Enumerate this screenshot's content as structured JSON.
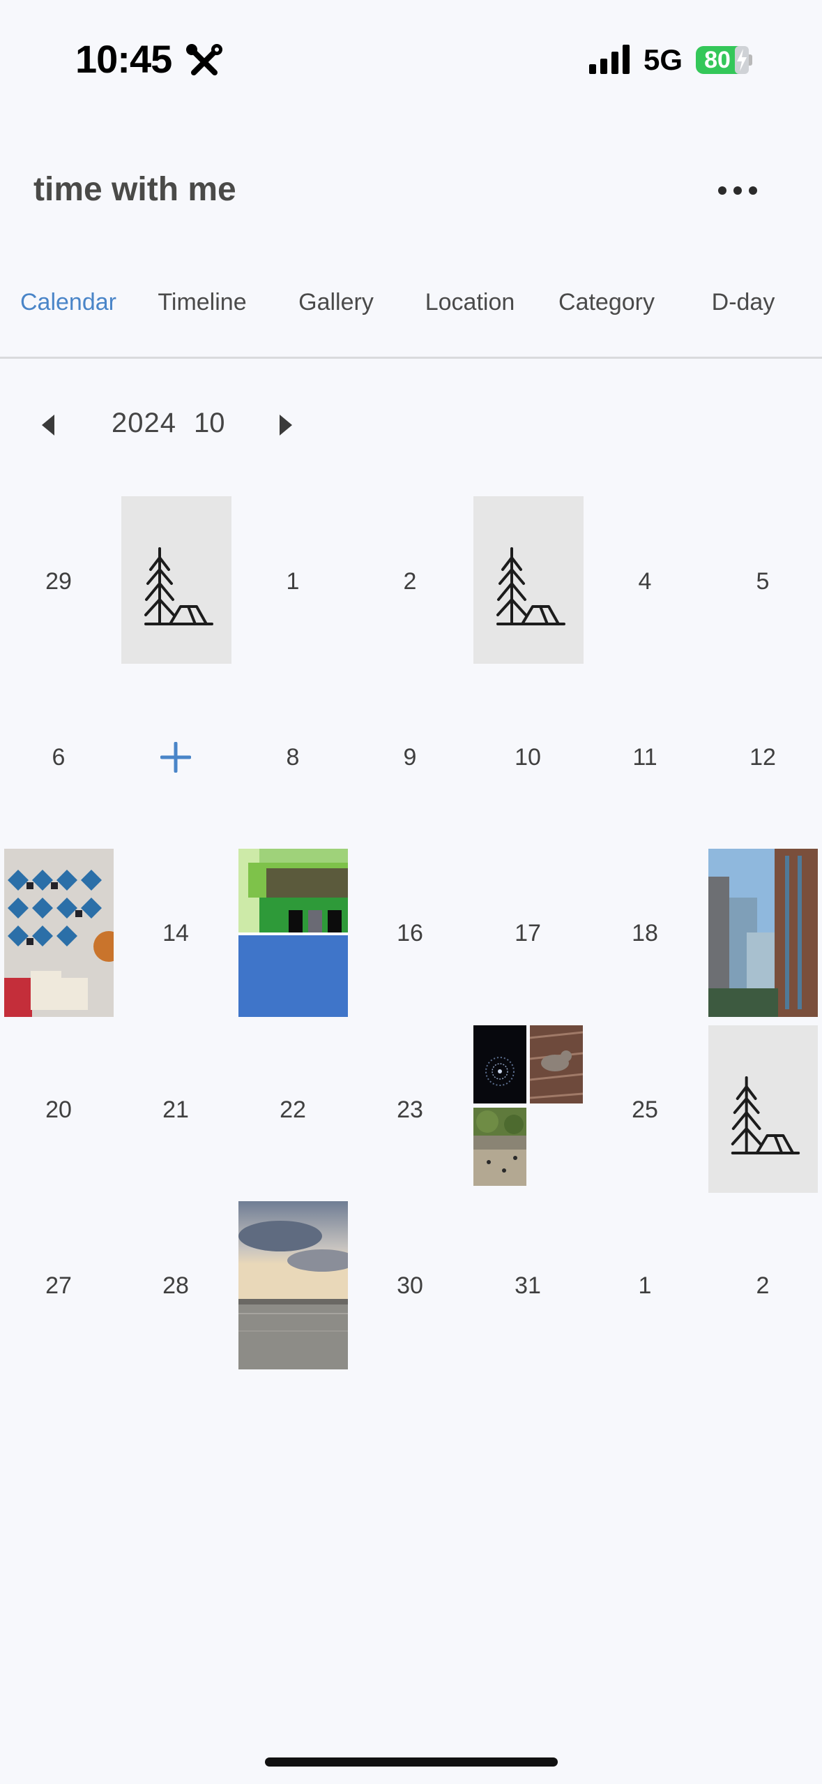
{
  "status_bar": {
    "time": "10:45",
    "network": "5G",
    "battery": "80",
    "tools_icon": "wrench-screwdriver-icon",
    "signal_icon": "cellular-signal-icon"
  },
  "header": {
    "title": "time with me",
    "more_icon": "ellipsis-icon"
  },
  "tabs": [
    {
      "label": "Calendar",
      "active": true
    },
    {
      "label": "Timeline",
      "active": false
    },
    {
      "label": "Gallery",
      "active": false
    },
    {
      "label": "Location",
      "active": false
    },
    {
      "label": "Category",
      "active": false
    },
    {
      "label": "D-day",
      "active": false
    }
  ],
  "month_nav": {
    "year": "2024",
    "month": "10",
    "prev_icon": "triangle-left-icon",
    "next_icon": "triangle-right-icon"
  },
  "colors": {
    "accent": "#4a85c8",
    "background": "#f7f8fc",
    "text": "#3f3f3f",
    "battery": "#34c759"
  },
  "calendar": {
    "week1": {
      "d0": "29",
      "d2": "1",
      "d3": "2",
      "d5": "4",
      "d6": "5"
    },
    "week2": {
      "d0": "6",
      "d2": "8",
      "d3": "9",
      "d4": "10",
      "d5": "11",
      "d6": "12"
    },
    "week3": {
      "d1": "14",
      "d3": "16",
      "d4": "17",
      "d5": "18"
    },
    "week4": {
      "d0": "20",
      "d1": "21",
      "d2": "22",
      "d3": "23",
      "d5": "25"
    },
    "week5": {
      "d0": "27",
      "d1": "28",
      "d3": "30",
      "d4": "31",
      "d5": "1",
      "d6": "2"
    },
    "add_icon": "plus-icon"
  }
}
